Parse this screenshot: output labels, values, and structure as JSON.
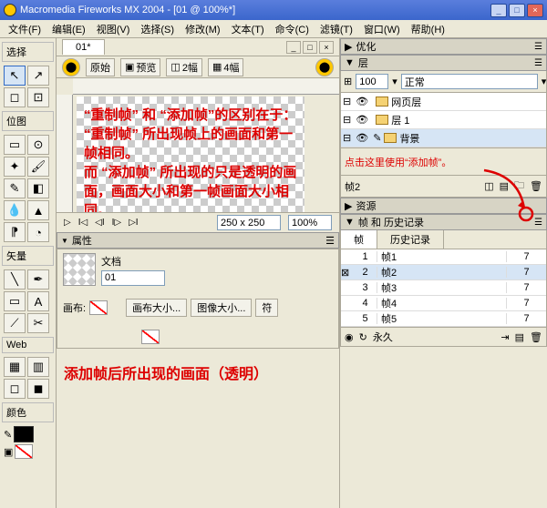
{
  "title": "Macromedia Fireworks MX 2004 - [01 @ 100%*]",
  "menu": [
    "文件(F)",
    "编辑(E)",
    "视图(V)",
    "选择(S)",
    "修改(M)",
    "文本(T)",
    "命令(C)",
    "滤镜(T)",
    "窗口(W)",
    "帮助(H)"
  ],
  "tools": {
    "select": "选择",
    "bitmap": "位图",
    "vector": "矢量",
    "web": "Web",
    "color": "颜色"
  },
  "doc": {
    "tab": "01*",
    "original": "原始",
    "preview": "预览",
    "two": "2幅",
    "four": "4幅"
  },
  "canvas_text": "“重制帧” 和 “添加帧”的区别在于：\n“重制帧” 所出现帧上的画面和第一帧相同。\n而 “添加帧” 所出现的只是透明的画面，画面大小和第一帧画面大小相同。\n大家可根据动态的效果来选择添加帧的类型。",
  "playbar": {
    "dim": "250 x 250",
    "zoom": "100%"
  },
  "props": {
    "header": "属性",
    "doc_lbl": "文档",
    "doc_name": "01",
    "canvas_lbl": "画布:",
    "canvas_size": "画布大小...",
    "image_size": "图像大小...",
    "fit": "符"
  },
  "bottom_note": "添加帧后所出现的画面（透明）",
  "right": {
    "optimize": "优化",
    "layers": "层",
    "opacity": "100",
    "blend": "正常",
    "layer_rows": [
      {
        "name": "网页层"
      },
      {
        "name": "层 1"
      },
      {
        "name": "背景",
        "sel": true
      }
    ],
    "annot": "点击这里使用“添加帧”。",
    "frame_label": "帧2",
    "assets": "资源",
    "frames_history": "帧 和 历史记录",
    "tab_frames": "帧",
    "tab_history": "历史记录",
    "frames": [
      {
        "n": "1",
        "name": "帧1",
        "d": "7"
      },
      {
        "n": "2",
        "name": "帧2",
        "d": "7",
        "sel": true
      },
      {
        "n": "3",
        "name": "帧3",
        "d": "7"
      },
      {
        "n": "4",
        "name": "帧4",
        "d": "7"
      },
      {
        "n": "5",
        "name": "帧5",
        "d": "7"
      }
    ],
    "forever": "永久"
  }
}
